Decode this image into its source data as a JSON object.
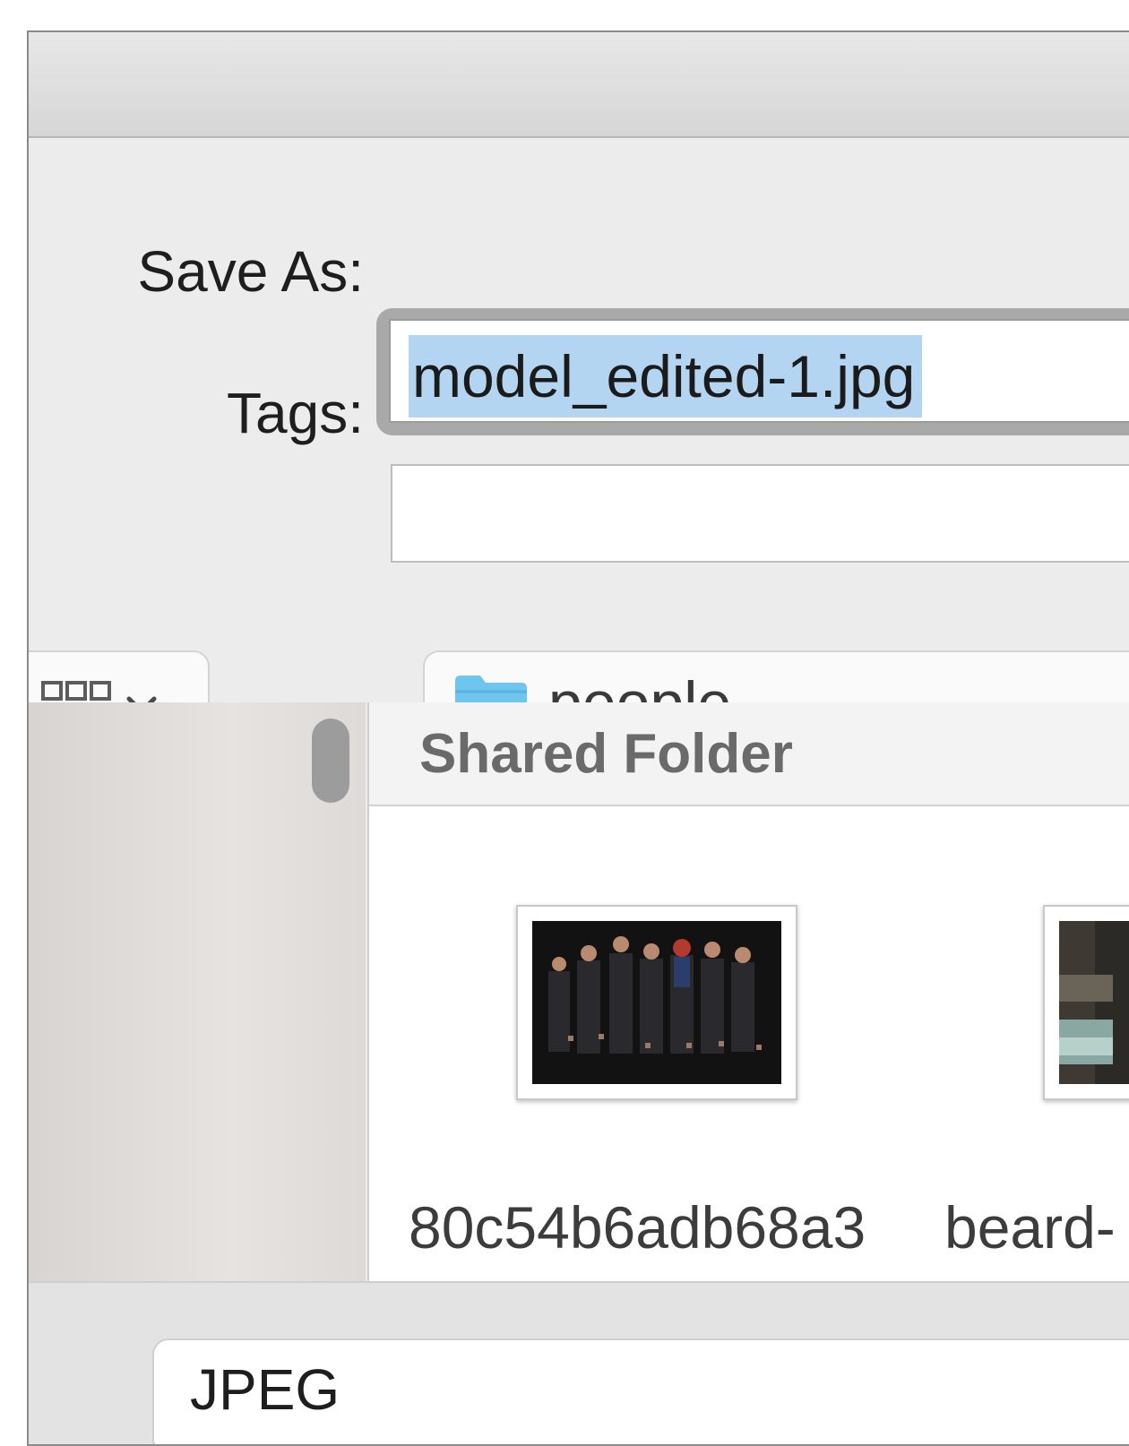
{
  "dialog": {
    "save_as_label": "Save As:",
    "save_as_value": "model_edited-1.jpg",
    "tags_label": "Tags:",
    "tags_value": ""
  },
  "toolbar": {
    "view_icon": "icon-view-grid-icon",
    "view_chevron_icon": "chevron-down-icon",
    "location_icon": "folder-icon",
    "location_label": "people"
  },
  "browser": {
    "section_title": "Shared Folder",
    "files": [
      {
        "name": "80c54b6adb68a3"
      },
      {
        "name": "beard-"
      }
    ]
  },
  "format": {
    "selected": "JPEG"
  },
  "colors": {
    "selection": "#b4d5f2",
    "folder": "#6ec6ee",
    "focus_ring": "#a9a9a9"
  }
}
